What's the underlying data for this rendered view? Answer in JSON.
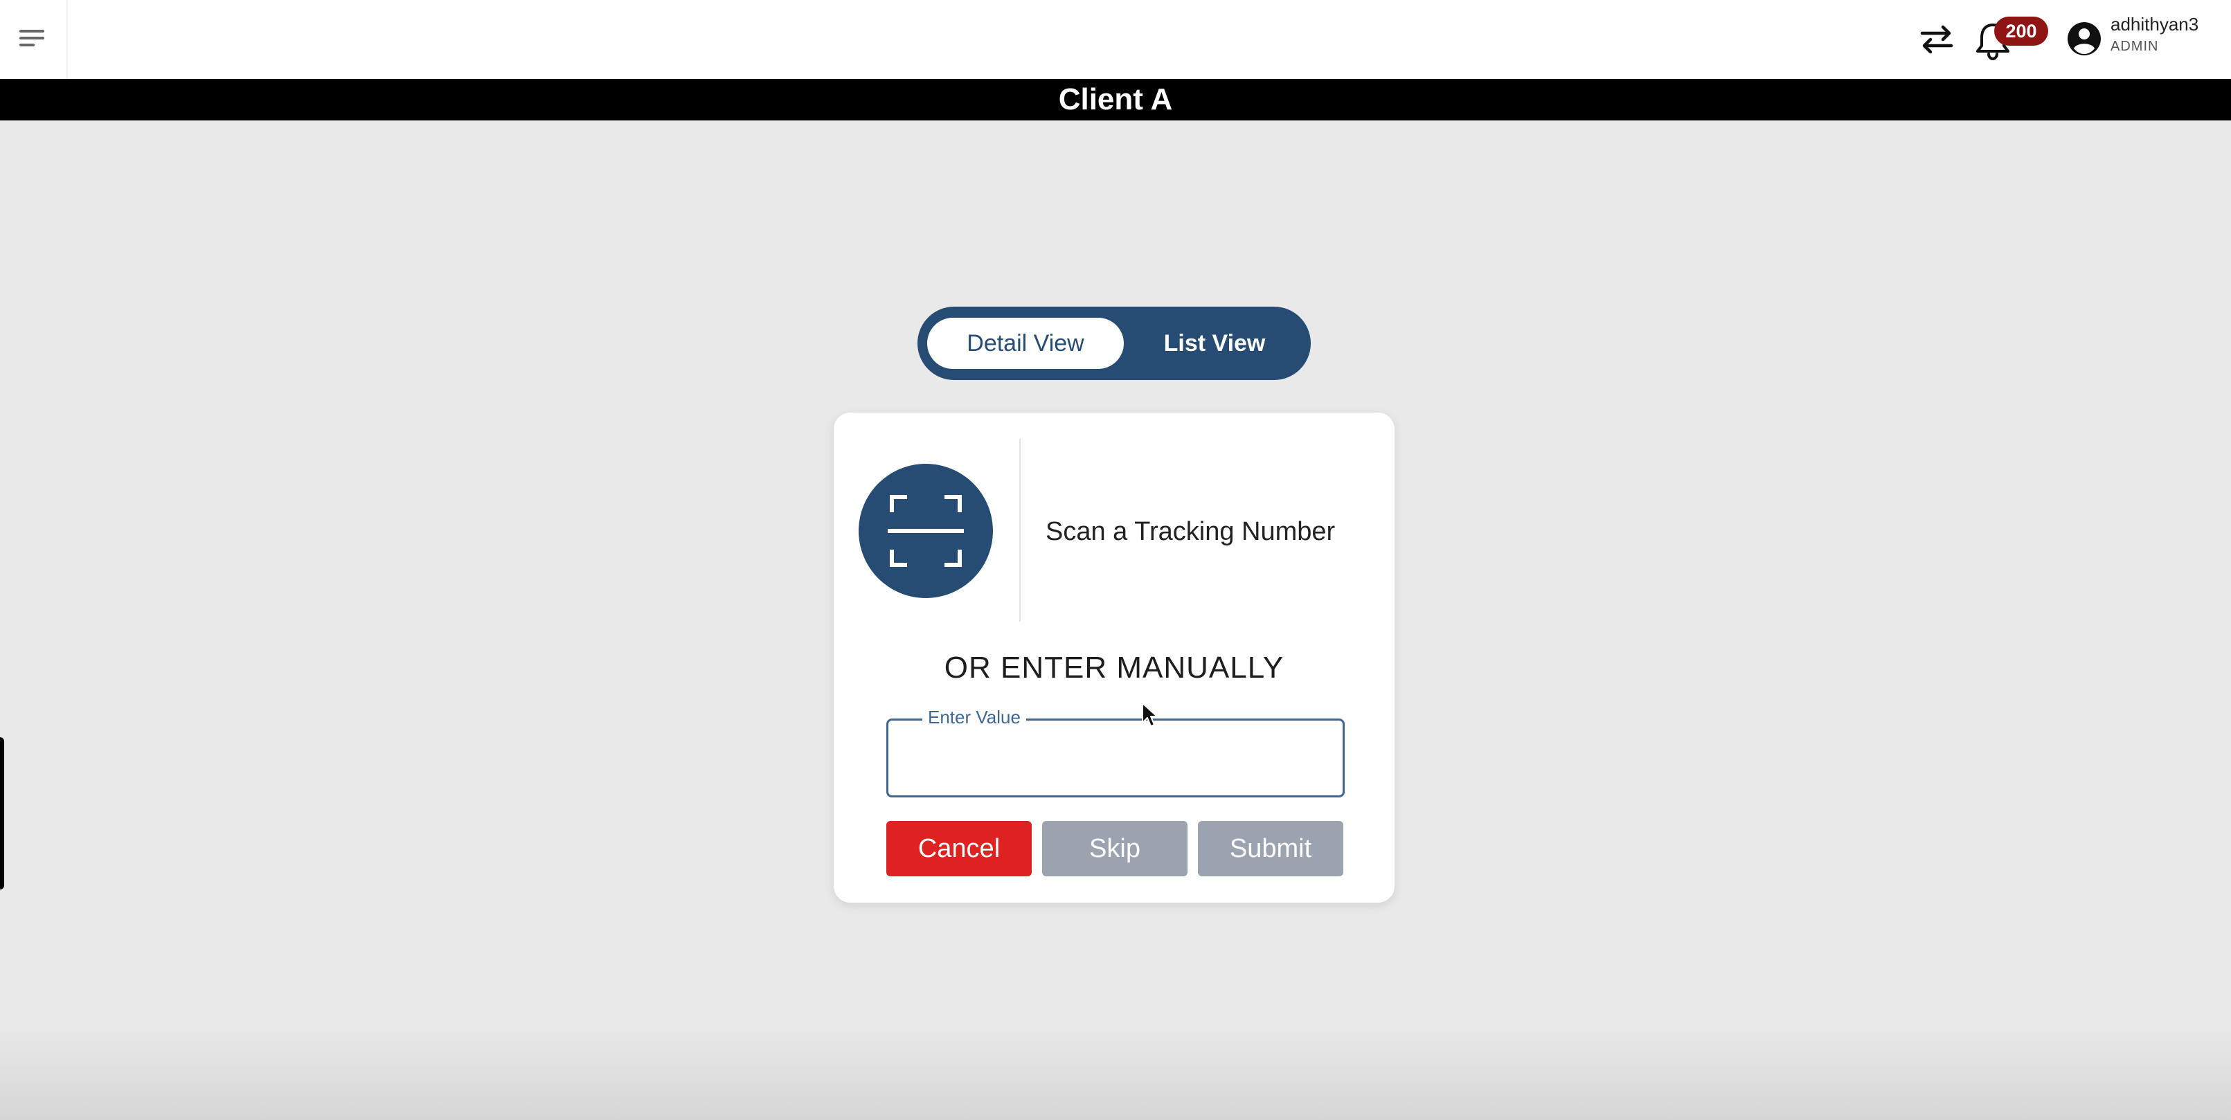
{
  "topbar": {
    "menu_icon": "menu-icon",
    "transfer_icon": "swap-arrows-icon",
    "notifications": {
      "icon": "bell-icon",
      "count": "200",
      "badge_color": "#8f1414"
    },
    "user": {
      "icon": "account-circle-icon",
      "name": "adhithyan3",
      "role": "ADMIN"
    }
  },
  "client": {
    "name": "Client A"
  },
  "view_toggle": {
    "options": [
      {
        "label": "Detail View",
        "selected": true
      },
      {
        "label": "List View",
        "selected": false
      }
    ],
    "accent": "#264c73"
  },
  "scan_card": {
    "scan_icon": "barcode-scan-icon",
    "scan_label": "Scan a Tracking Number",
    "or_label": "OR ENTER MANUALLY",
    "input": {
      "label": "Enter Value",
      "value": "",
      "placeholder": ""
    },
    "buttons": {
      "cancel": {
        "label": "Cancel",
        "color": "#de2121"
      },
      "skip": {
        "label": "Skip",
        "color": "#9ba3ae"
      },
      "submit": {
        "label": "Submit",
        "color": "#9ba3ae"
      }
    }
  }
}
